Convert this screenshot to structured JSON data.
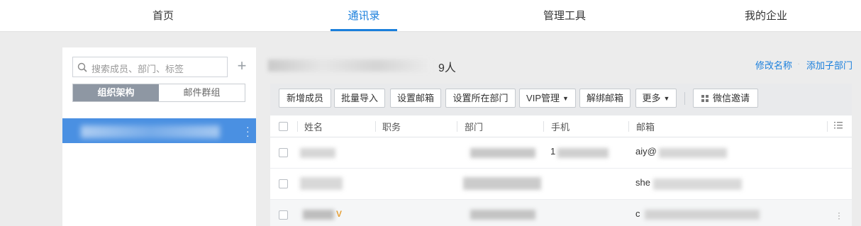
{
  "top_nav": {
    "tabs": [
      {
        "label": "首页",
        "active": false
      },
      {
        "label": "通讯录",
        "active": true
      },
      {
        "label": "管理工具",
        "active": false
      },
      {
        "label": "我的企业",
        "active": false
      }
    ]
  },
  "sidebar": {
    "search_placeholder": "搜索成员、部门、标签",
    "add_icon": "plus-icon",
    "segments": [
      "组织架构",
      "邮件群组"
    ],
    "active_segment": "组织架构"
  },
  "main": {
    "member_count_text": "9人",
    "links": [
      "修改名称",
      "添加子部门"
    ],
    "toolbar": {
      "buttons": [
        "新增成员",
        "批量导入",
        "设置邮箱",
        "设置所在部门",
        "VIP管理",
        "解绑邮箱",
        "更多",
        "微信邀请"
      ]
    },
    "table": {
      "columns": [
        "姓名",
        "职务",
        "部门",
        "手机",
        "邮箱"
      ],
      "rows": [
        {
          "mobile_prefix": "1",
          "email_prefix": "aiy@"
        },
        {
          "email_prefix": "she"
        },
        {
          "email_prefix": "c",
          "vip_icon": "vip-icon"
        }
      ]
    }
  },
  "colors": {
    "accent": "#1a7fdc",
    "selected_tree": "#4a90e2",
    "vip": "#e6a23c"
  }
}
